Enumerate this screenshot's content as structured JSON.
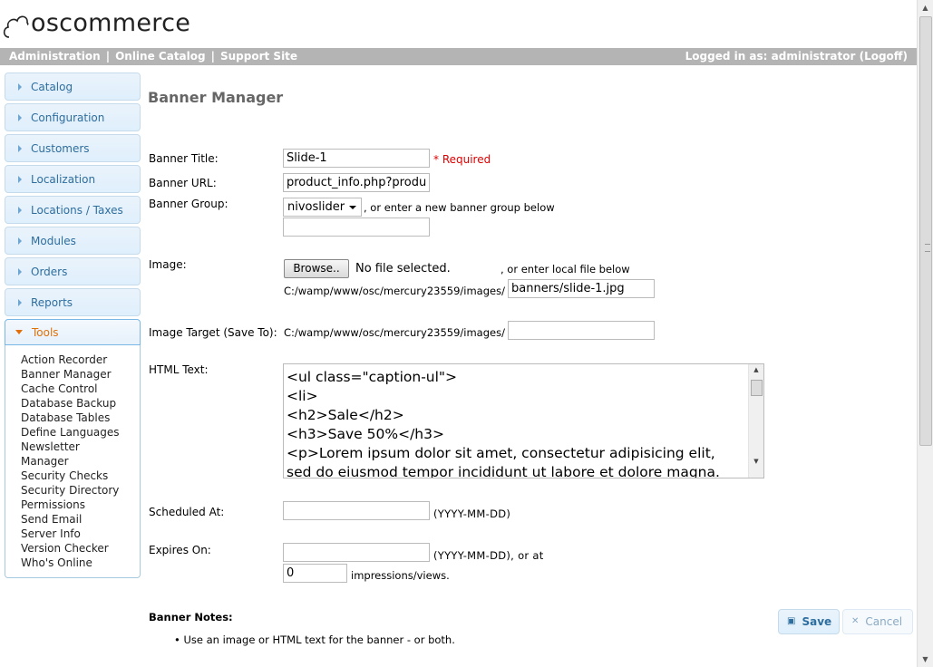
{
  "brand": {
    "name": "oscommerce"
  },
  "topbar": {
    "links": [
      "Administration",
      "Online Catalog",
      "Support Site"
    ],
    "separator": "|",
    "logged_in": "Logged in as: administrator (Logoff)"
  },
  "sidebar": {
    "items": [
      "Catalog",
      "Configuration",
      "Customers",
      "Localization",
      "Locations / Taxes",
      "Modules",
      "Orders",
      "Reports"
    ],
    "open": {
      "label": "Tools",
      "subitems": [
        "Action Recorder",
        "Banner Manager",
        "Cache Control",
        "Database Backup",
        "Database Tables",
        "Define Languages",
        "Newsletter",
        "Manager",
        "Security Checks",
        "Security Directory",
        "Permissions",
        "Send Email",
        "Server Info",
        "Version Checker",
        "Who's Online"
      ]
    }
  },
  "page": {
    "title": "Banner Manager"
  },
  "form": {
    "title_label": "Banner Title:",
    "title_value": "Slide-1",
    "required": "* Required",
    "url_label": "Banner URL:",
    "url_value": "product_info.php?produ",
    "group_label": "Banner Group:",
    "group_selected": "nivoslider",
    "group_hint": ", or enter a new banner group below",
    "group_new_value": "",
    "image_label": "Image:",
    "browse_label": "Browse..",
    "no_file": "No file selected.",
    "image_hint": ", or enter local file below",
    "image_path_prefix": "C:/wamp/www/osc/mercury23559/images/",
    "image_local_value": "banners/slide-1.jpg",
    "target_label": "Image Target (Save To):",
    "target_prefix": "C:/wamp/www/osc/mercury23559/images/",
    "target_value": "",
    "html_label": "HTML Text:",
    "html_text": "<ul class=\"caption-ul\">\n<li>\n<h2>Sale</h2>\n<h3>Save 50%</h3>\n<p>Lorem ipsum dolor sit amet, consectetur adipisicing elit,\nsed do eiusmod tempor incididunt ut labore et dolore magna.",
    "scheduled_label": "Scheduled At:",
    "scheduled_value": "",
    "date_format": "(YYYY-MM-DD)",
    "expires_label": "Expires On:",
    "expires_value": "",
    "expires_hint": "(YYYY-MM-DD), or at",
    "impressions_value": "0",
    "impressions_label": "impressions/views."
  },
  "notes": {
    "title": "Banner Notes:",
    "item": "Use an image or HTML text for the banner - or both."
  },
  "buttons": {
    "save": "Save",
    "cancel": "Cancel"
  }
}
